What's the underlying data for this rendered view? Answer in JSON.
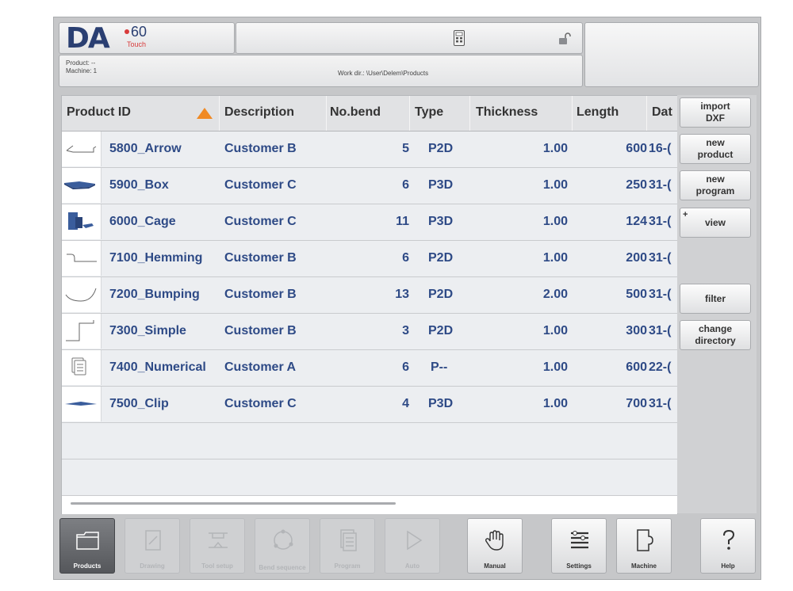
{
  "app": {
    "logo_main": "DA",
    "logo_model": "60",
    "logo_sub": "Touch"
  },
  "info": {
    "product": "Product: --",
    "machine": "Machine: 1",
    "work_dir": "Work dir.: \\User\\Delem\\Products"
  },
  "table": {
    "columns": [
      "Product ID",
      "Description",
      "No.bend",
      "Type",
      "Thickness",
      "Length",
      "Dat"
    ],
    "sort_column": "Product ID",
    "sort_direction": "ascending",
    "rows": [
      {
        "id": "5800_Arrow",
        "description": "Customer B",
        "bends": "5",
        "type": "P2D",
        "thickness": "1.00",
        "length": "600",
        "date": "16-("
      },
      {
        "id": "5900_Box",
        "description": "Customer C",
        "bends": "6",
        "type": "P3D",
        "thickness": "1.00",
        "length": "250",
        "date": "31-("
      },
      {
        "id": "6000_Cage",
        "description": "Customer C",
        "bends": "11",
        "type": "P3D",
        "thickness": "1.00",
        "length": "124",
        "date": "31-("
      },
      {
        "id": "7100_Hemming",
        "description": "Customer B",
        "bends": "6",
        "type": "P2D",
        "thickness": "1.00",
        "length": "200",
        "date": "31-("
      },
      {
        "id": "7200_Bumping",
        "description": "Customer B",
        "bends": "13",
        "type": "P2D",
        "thickness": "2.00",
        "length": "500",
        "date": "31-("
      },
      {
        "id": "7300_Simple",
        "description": "Customer B",
        "bends": "3",
        "type": "P2D",
        "thickness": "1.00",
        "length": "300",
        "date": "31-("
      },
      {
        "id": "7400_Numerical",
        "description": "Customer A",
        "bends": "6",
        "type": "P--",
        "thickness": "1.00",
        "length": "600",
        "date": "22-("
      },
      {
        "id": "7500_Clip",
        "description": "Customer C",
        "bends": "4",
        "type": "P3D",
        "thickness": "1.00",
        "length": "700",
        "date": "31-("
      }
    ]
  },
  "side_buttons": {
    "import_dxf": "import DXF",
    "new_product": "new product",
    "new_program": "new program",
    "view": "view",
    "view_plus": "+",
    "filter": "filter",
    "change_directory": "change directory"
  },
  "nav": {
    "products": "Products",
    "drawing": "Drawing",
    "tool_setup": "Tool setup",
    "bend_sequence": "Bend sequence",
    "program": "Program",
    "auto": "Auto",
    "manual": "Manual",
    "settings": "Settings",
    "machine": "Machine",
    "help": "Help"
  },
  "colors": {
    "accent_orange": "#f08a24",
    "text_blue": "#2e4a86",
    "logo_red": "#d83b3b",
    "logo_navy": "#2a3f72"
  },
  "icons": [
    "calculator-icon",
    "unlock-icon",
    "sort-ascending-icon",
    "folder-icon",
    "drawing-icon",
    "tool-setup-icon",
    "bend-sequence-icon",
    "program-icon",
    "play-icon",
    "hand-icon",
    "settings-list-icon",
    "machine-icon",
    "help-icon"
  ]
}
